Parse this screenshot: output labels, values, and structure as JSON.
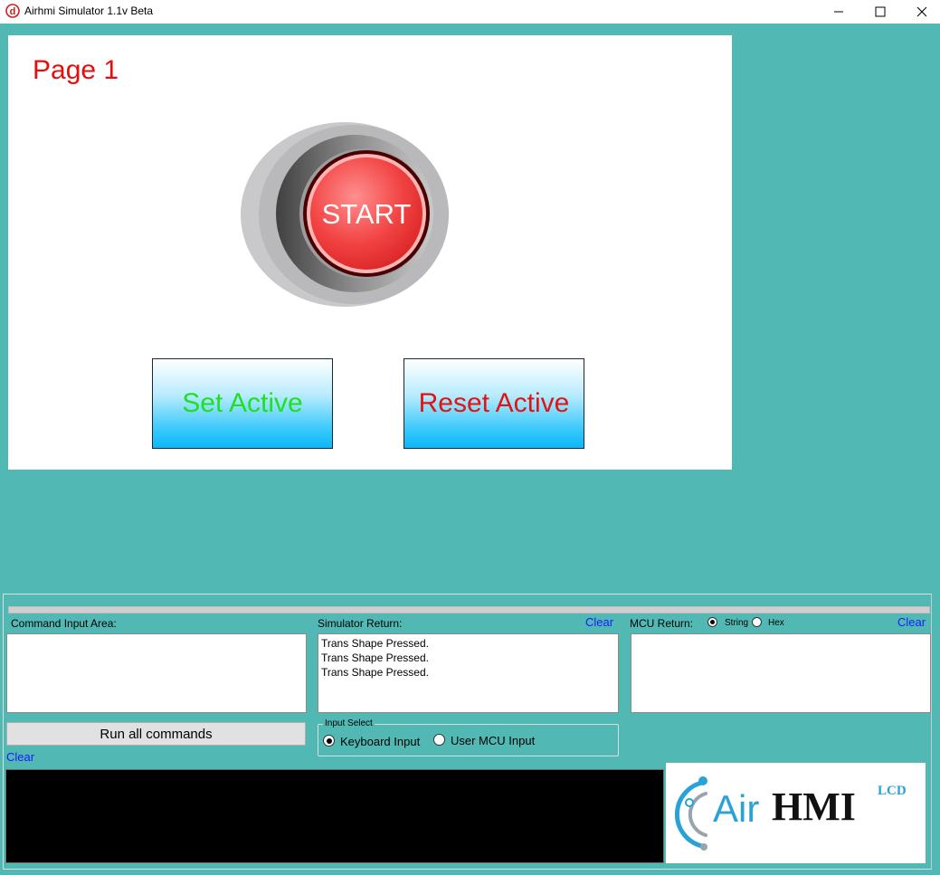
{
  "window": {
    "title": "Airhmi Simulator 1.1v Beta",
    "icon": "airhmi-app-icon",
    "controls": [
      "minimize-icon",
      "maximize-icon",
      "close-icon"
    ]
  },
  "screen": {
    "page_title": "Page 1",
    "start_button": {
      "label": "START",
      "color": "#f24444"
    },
    "set_active_button": {
      "label": "Set Active",
      "color": "#21e021"
    },
    "reset_active_button": {
      "label": "Reset Active",
      "color": "#e01414"
    }
  },
  "command_input": {
    "label": "Command Input Area:",
    "value": "",
    "run_button": "Run all commands",
    "clear": "Clear"
  },
  "simulator_return": {
    "label": "Simulator Return:",
    "clear": "Clear",
    "lines": [
      "Trans Shape Pressed.",
      "Trans Shape Pressed.",
      "Trans Shape Pressed."
    ]
  },
  "mcu_return": {
    "label": "MCU Return:",
    "clear": "Clear",
    "formats": [
      {
        "label": "String",
        "selected": true
      },
      {
        "label": "Hex",
        "selected": false
      }
    ],
    "value": ""
  },
  "input_select": {
    "title": "Input Select",
    "options": [
      {
        "label": "Keyboard Input",
        "selected": true
      },
      {
        "label": "User MCU Input",
        "selected": false
      }
    ]
  },
  "logo": {
    "text_air": "Air",
    "text_hmi": "HMI",
    "text_lcd": "LCD"
  },
  "colors": {
    "background": "#51b8b4",
    "link": "#1a1aff",
    "page_title": "#e50d0d"
  }
}
